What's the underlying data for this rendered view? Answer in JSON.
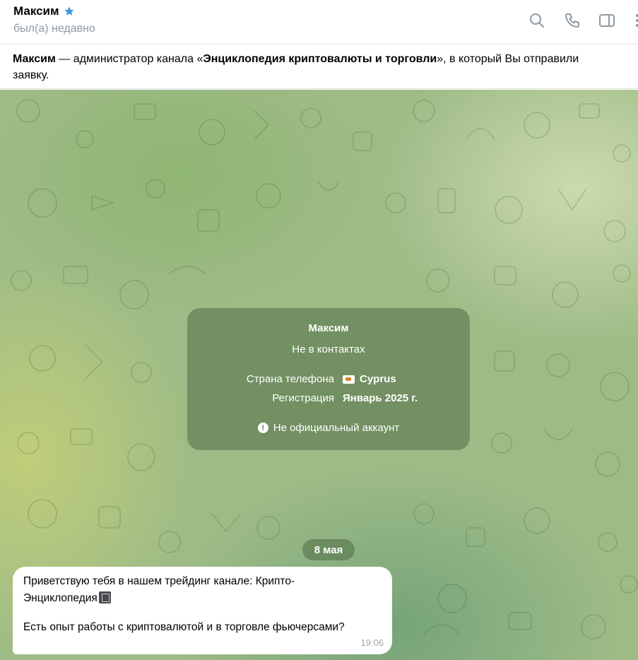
{
  "header": {
    "contact_name": "Максим",
    "status": "был(а) недавно",
    "icons": [
      "verified-star-icon",
      "search-icon",
      "phone-icon",
      "sidebar-panel-icon",
      "more-vertical-icon"
    ]
  },
  "banner": {
    "name": "Максим",
    "text_before_channel": " — администратор канала «",
    "channel": "Энциклопедия криптовалюты и торговли",
    "text_after_channel": "», в который Вы отправили",
    "line2": "заявку."
  },
  "info_card": {
    "name": "Максим",
    "subtitle": "Не в контактах",
    "phone_country_label": "Страна телефона",
    "phone_country_value": "Cyprus",
    "registration_label": "Регистрация",
    "registration_value": "Январь 2025 г.",
    "note": "Не официальный аккаунт"
  },
  "date_separator": "8 мая",
  "message": {
    "line1": "Приветствую тебя в нашем трейдинг канале: Крипто-",
    "line2": "Энциклопедия",
    "line3": "Есть опыт работы с криптовалютой и в торговле фьючерсами?",
    "time": "19:06"
  },
  "colors": {
    "accent": "#3a9be0",
    "status_gray": "#8e99a4",
    "card_bg": "#4e6e46"
  }
}
